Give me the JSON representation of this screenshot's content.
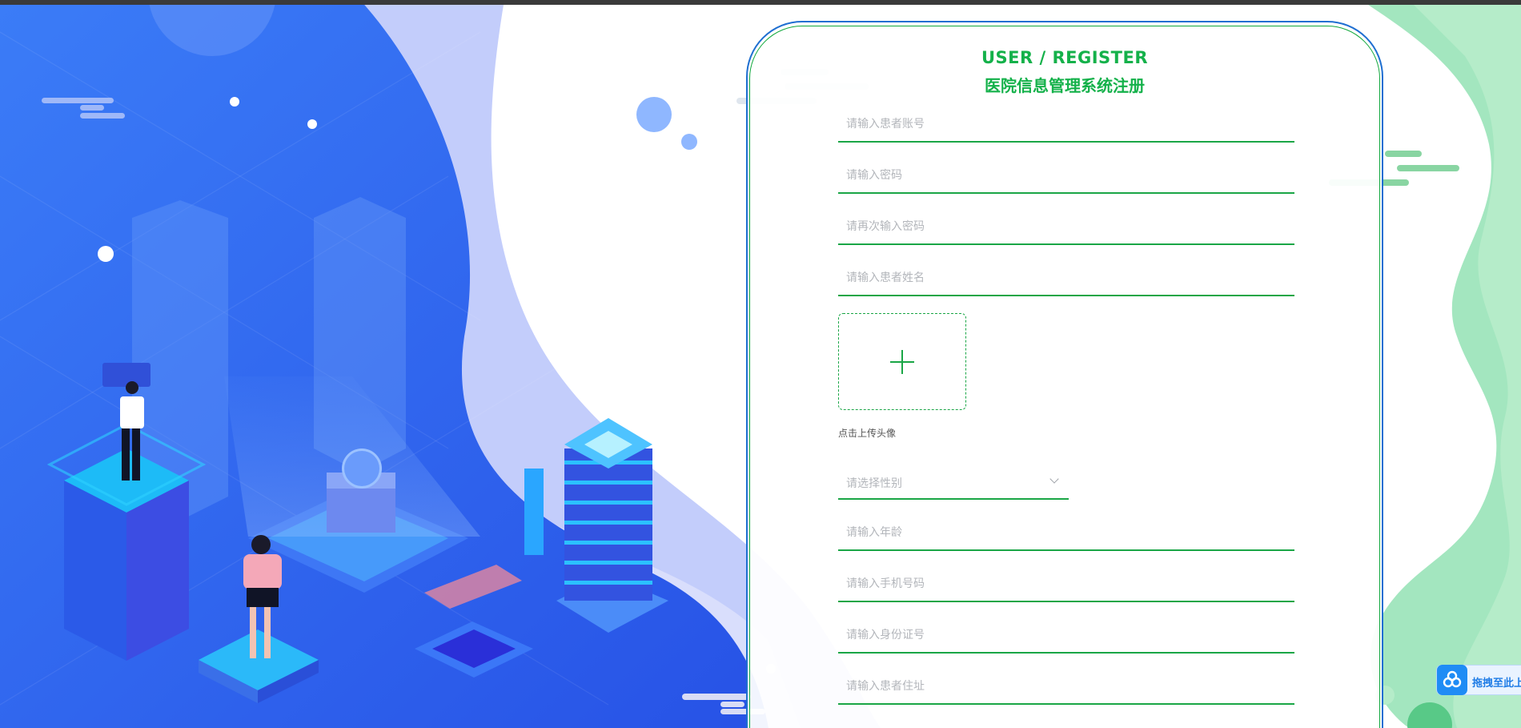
{
  "header": {
    "title_en": "USER / REGISTER",
    "title_cn": "医院信息管理系统注册"
  },
  "form": {
    "account_placeholder": "请输入患者账号",
    "password_placeholder": "请输入密码",
    "confirm_password_placeholder": "请再次输入密码",
    "name_placeholder": "请输入患者姓名",
    "avatar_upload_label": "点击上传头像",
    "gender_placeholder": "请选择性别",
    "age_placeholder": "请输入年龄",
    "phone_placeholder": "请输入手机号码",
    "id_card_placeholder": "请输入身份证号",
    "address_placeholder": "请输入患者住址"
  },
  "widget": {
    "drag_label": "拖拽至此上"
  },
  "icons": {
    "upload": "plus-icon",
    "select_arrow": "chevron-down-icon",
    "widget": "baidu-netdisk-icon"
  },
  "colors": {
    "accent_green": "#14b14a",
    "card_border_blue": "#1f6fd1",
    "background_blue": "#2f6df0",
    "background_green": "#9fe0b7"
  }
}
